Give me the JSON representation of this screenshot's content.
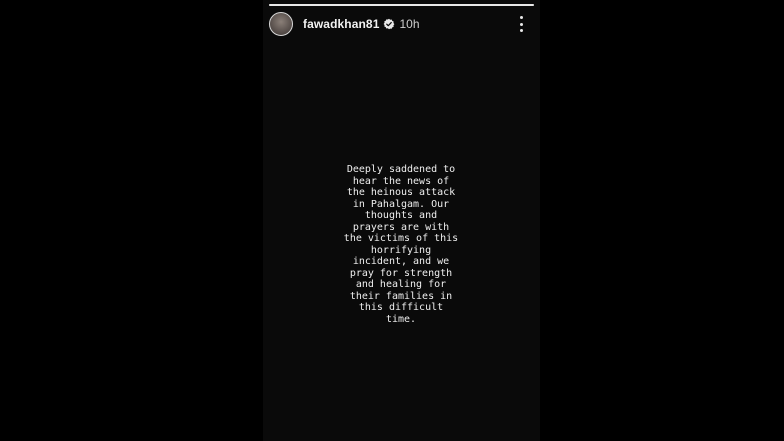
{
  "story": {
    "progress": 1.0,
    "username": "fawadkhan81",
    "verified": true,
    "timestamp": "10h",
    "text": "Deeply saddened to\nhear the news of\nthe heinous attack\nin Pahalgam. Our\nthoughts and\nprayers are with\nthe victims of this\nhorrifying\nincident, and we\npray for strength\nand healing for\ntheir families in\nthis difficult\ntime.",
    "icons": {
      "avatar": "avatar",
      "verified": "verified-badge-icon",
      "more": "more-vertical-icon"
    },
    "colors": {
      "background": "#0a0a0a",
      "text": "#efefef",
      "verified_badge": "#e8e8e8"
    }
  }
}
